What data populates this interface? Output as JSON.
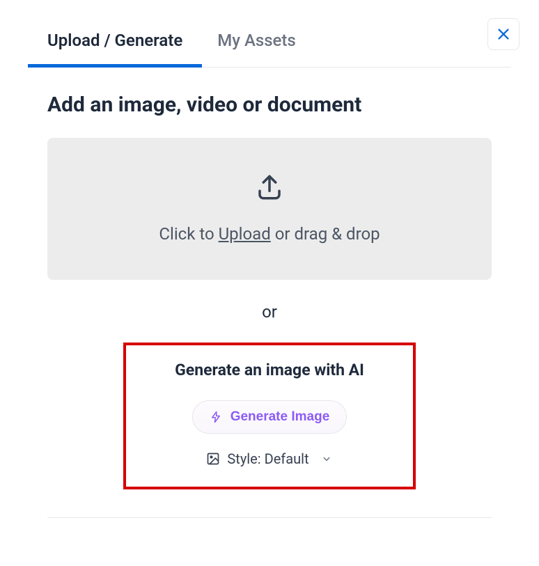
{
  "tabs": {
    "upload_generate": "Upload / Generate",
    "my_assets": "My Assets"
  },
  "heading": "Add an image, video or document",
  "upload_zone": {
    "prefix": "Click to ",
    "link_word": "Upload",
    "suffix": " or drag & drop"
  },
  "separator": "or",
  "ai_section": {
    "heading": "Generate an image with AI",
    "button_label": "Generate Image",
    "style_label": "Style: Default"
  }
}
